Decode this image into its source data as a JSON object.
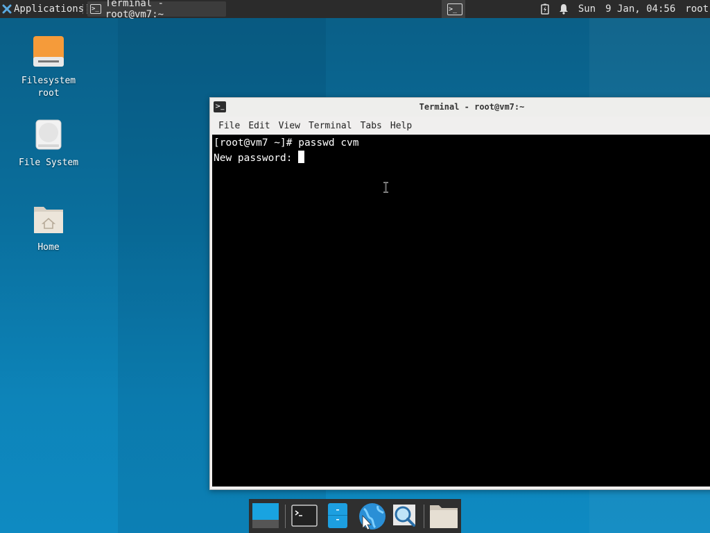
{
  "panel": {
    "applications_label": "Applications",
    "task_title": "Terminal - root@vm7:~",
    "day": "Sun",
    "datetime": "9 Jan, 04:56",
    "user": "root"
  },
  "desktop": {
    "icons": [
      {
        "label": "Filesystem\nroot"
      },
      {
        "label": "File System"
      },
      {
        "label": "Home"
      }
    ]
  },
  "terminal": {
    "title": "Terminal - root@vm7:~",
    "menu": [
      "File",
      "Edit",
      "View",
      "Terminal",
      "Tabs",
      "Help"
    ],
    "line1": "[root@vm7 ~]# passwd cvm",
    "line2": "New password: "
  },
  "colors": {
    "desktop_accent": "#0a6e9c",
    "panel_bg": "#2b2b2b",
    "terminal_bg": "#000000"
  }
}
